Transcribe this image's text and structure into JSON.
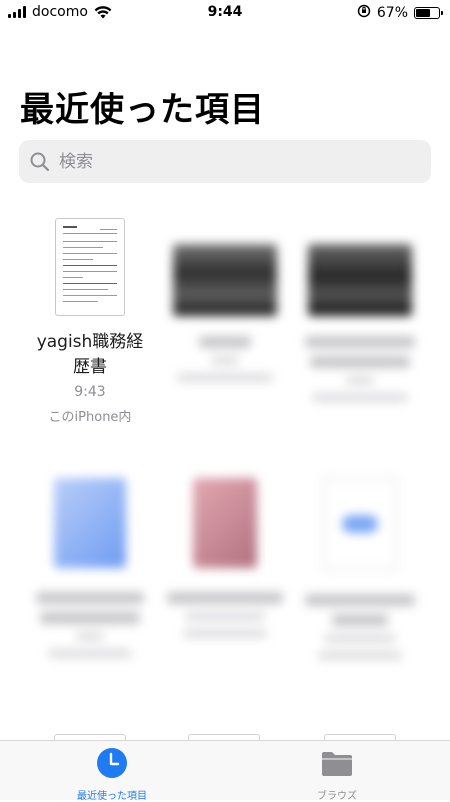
{
  "status_bar": {
    "carrier": "docomo",
    "time": "9:44",
    "battery_percent": "67%",
    "battery_level": 0.67
  },
  "title": "最近使った項目",
  "search": {
    "placeholder": "検索"
  },
  "files": [
    {
      "name_line1": "yagish職務経",
      "name_line2": "歴書",
      "time": "9:43",
      "location": "このiPhone内"
    }
  ],
  "tabs": [
    {
      "label": "最近使った項目",
      "active": true
    },
    {
      "label": "ブラウズ",
      "active": false
    }
  ],
  "colors": {
    "accent": "#1f7bf2",
    "inactive": "#8e8e93"
  }
}
